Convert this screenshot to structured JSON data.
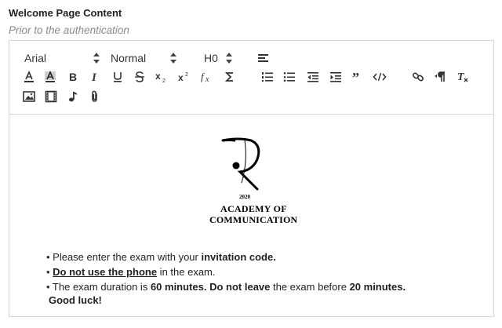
{
  "field": {
    "title": "Welcome Page Content",
    "subtitle": "Prior to the authentication"
  },
  "toolbar": {
    "font_select": "Arial",
    "size_select": "Normal",
    "heading_select": "H0"
  },
  "content": {
    "logo": {
      "year": "2020",
      "line1": "ACADEMY OF",
      "line2": "COMMUNICATION"
    },
    "line1": {
      "prefix": "• Please enter the exam with your ",
      "bold": "invitation code."
    },
    "line2": {
      "prefix": "• ",
      "bold_underline": "Do not use the phone",
      "suffix": " in the exam."
    },
    "line3": {
      "prefix": "• The exam duration is ",
      "bold1": "60 minutes.",
      "space": " ",
      "bold2": "Do not leave",
      "middle": " the exam before ",
      "bold3": "20 minutes."
    },
    "closing": "Good luck!"
  },
  "icons": {
    "text_color": "text-color-icon",
    "background_color": "background-color-icon",
    "bold": "bold-icon",
    "italic": "italic-icon",
    "underline": "underline-icon",
    "strike": "strikethrough-icon",
    "subscript": "subscript-icon",
    "superscript": "superscript-icon",
    "formula": "formula-icon",
    "sum": "sigma-icon",
    "align": "align-icon",
    "ordered_list": "ordered-list-icon",
    "bullet_list": "bullet-list-icon",
    "outdent": "outdent-icon",
    "indent": "indent-icon",
    "blockquote": "blockquote-icon",
    "code": "code-icon",
    "link": "link-icon",
    "direction": "text-direction-icon",
    "clear": "clear-format-icon",
    "image": "image-icon",
    "video": "video-icon",
    "audio": "audio-icon",
    "attachment": "attachment-icon"
  }
}
